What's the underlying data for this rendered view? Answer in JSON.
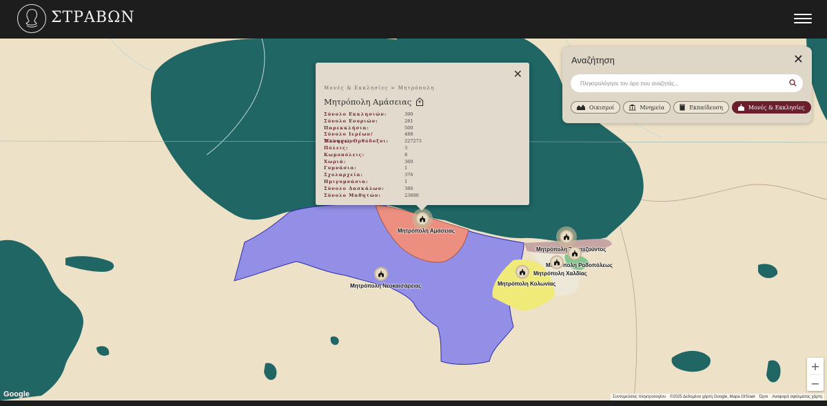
{
  "header": {
    "brand": "ΣΤΡΑΒΩΝ"
  },
  "popup": {
    "breadcrumb": "Μονές & Εκκλησίες > Μητρόπολη",
    "title": "Μητρόπολη Αμάσειας",
    "rows": [
      {
        "label": "Σύνολο Εκκλησιών:",
        "value": "390"
      },
      {
        "label": "Σύνολο Ενοριών:",
        "value": "281"
      },
      {
        "label": "Παρεκκλήσια:",
        "value": "500"
      },
      {
        "label": "Σύνολο Ιερέων/Μοναχών:",
        "value": "488"
      },
      {
        "label": "Έλληνες Ορθόδοξοι:",
        "value": "227273"
      },
      {
        "label": "Πόλεις:",
        "value": "3"
      },
      {
        "label": "Κωμοπόλεις:",
        "value": "8"
      },
      {
        "label": "Χωριά:",
        "value": "360"
      },
      {
        "label": "Γυμνάσια:",
        "value": "1"
      },
      {
        "label": "Σχολαρχεία:",
        "value": "376"
      },
      {
        "label": "Ημιγυμνάσια:",
        "value": "1"
      },
      {
        "label": "Σύνολο Δασκάλων:",
        "value": "386"
      },
      {
        "label": "Σύνολο Μαθητών:",
        "value": "23600"
      }
    ]
  },
  "search": {
    "title": "Αναζήτηση",
    "placeholder": "Πληκτρολόγησε τον όρο που αναζητάς...",
    "filters": [
      {
        "label": "Οικισμοί",
        "icon": "houses-icon",
        "active": false
      },
      {
        "label": "Μνημεία",
        "icon": "monument-icon",
        "active": false
      },
      {
        "label": "Εκπαίδευση",
        "icon": "book-icon",
        "active": false
      },
      {
        "label": "Μονές & Εκκλησίες",
        "icon": "church-icon",
        "active": true
      }
    ]
  },
  "markers": [
    {
      "label": "Μητρόπολη Αμάσειας"
    },
    {
      "label": "Μητρόπολη Νεοκαισάρειας"
    },
    {
      "label": "Μητρόπολη Τραπεζούντος"
    },
    {
      "label": "Μητρόπολη Ροδοπόλεως"
    },
    {
      "label": "Μητρόπολη Χαλδίας"
    },
    {
      "label": "Μητρόπολη Κολωνίας"
    }
  ],
  "map": {
    "google_logo": "Google",
    "zoom_in": "+",
    "zoom_out": "−",
    "attribution": [
      "Συντομεύσεις πληκτρολογίου",
      "©2025 Δεδομένα χάρτη Google, Mapa GISrael",
      "Όροι",
      "Αναφορά σφάλματος χάρτη"
    ]
  },
  "colors": {
    "sea": "#1f6665",
    "land": "#ede2c7",
    "amaseia": "#ec8f80",
    "neokaisareia": "#948fe6",
    "kolonia": "#f0ea79",
    "chaldia": "#ece7d6",
    "trapezous": "#c6a6a4",
    "rodopolis": "#86c58e",
    "accent": "#6b1f2c",
    "topbar": "#1d1d1d"
  }
}
